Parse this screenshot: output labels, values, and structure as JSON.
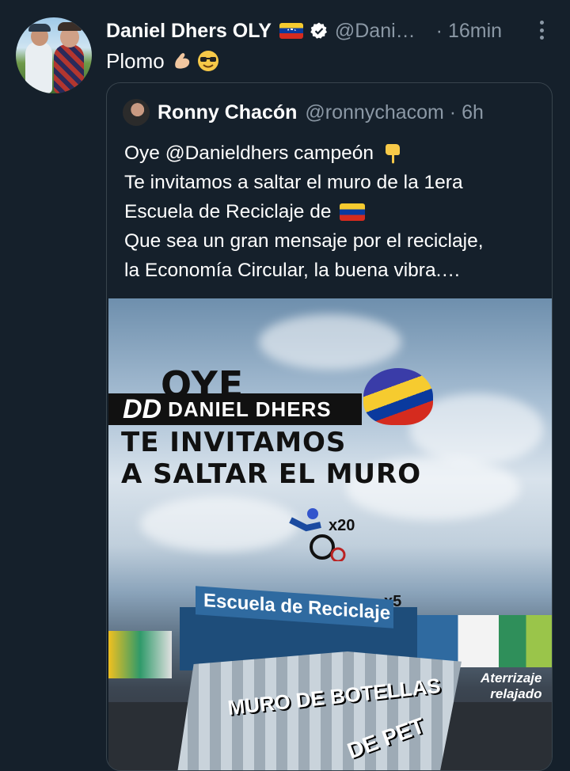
{
  "tweet": {
    "author_name": "Daniel Dhers OLY",
    "handle": "@Dani…",
    "time": "· 16min",
    "text": "Plomo",
    "emojis": [
      "flexed-biceps-emoji",
      "sunglasses-emoji"
    ]
  },
  "quoted": {
    "author_name": "Ronny Chacón",
    "handle": "@ronnychacom · 6h",
    "lines": [
      "Oye @Danieldhers campeón",
      "Te invitamos a saltar el muro de la 1era",
      "Escuela de Reciclaje de",
      "Que sea un gran mensaje por el reciclaje,",
      "la Economía Circular, la buena vibra.…"
    ]
  },
  "media": {
    "oye": "OYE",
    "brand_logo": "DD",
    "brand_name": "DANIEL DHERS",
    "invite_line1": "TE INVITAMOS",
    "invite_line2": "A SALTAR EL MURO",
    "multiplier_20": "x20",
    "multiplier_5": "x5",
    "sign": "Escuela de Reciclaje",
    "wall_line1": "MURO DE BOTELLAS",
    "wall_line2": "DE PET",
    "landing_line1": "Aterrizaje",
    "landing_line2": "relajado"
  },
  "colors": {
    "background": "#15202b",
    "secondary_text": "#8b98a5",
    "border": "#38444d",
    "verified_badge": "#ffffff"
  },
  "icons": [
    "verified-icon",
    "venezuela-flag-icon",
    "more-icon"
  ]
}
